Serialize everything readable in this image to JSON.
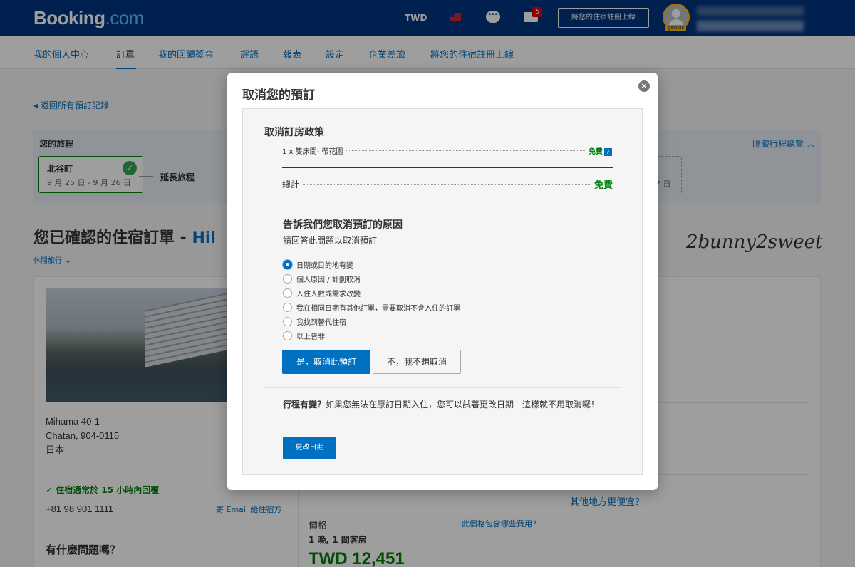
{
  "header": {
    "logo_main": "Booking",
    "logo_dot": ".com",
    "currency": "TWD",
    "mail_badge": "5",
    "list_property": "將您的住宿註冊上線",
    "genius": "genius"
  },
  "subnav": {
    "items": [
      {
        "label": "我的個人中心"
      },
      {
        "label": "訂單"
      },
      {
        "label": "我的回饋獎金"
      },
      {
        "label": "評語"
      },
      {
        "label": "報表"
      },
      {
        "label": "設定"
      },
      {
        "label": "企業差旅"
      },
      {
        "label": "將您的住宿註冊上線"
      }
    ]
  },
  "back_link": "◂ 返回所有預訂記錄",
  "trip": {
    "title": "您的旅程",
    "city": "北谷町",
    "dates": "9 月 25 日 - 9 月 26 日",
    "extend": "延長旅程",
    "hide_overview": "隱藏行程總覽 ︿",
    "dashed_card_text": "7 日"
  },
  "confirm": {
    "title": "您已確認的住宿訂單 - ",
    "title_hl": "Hil",
    "leisure": "休閒旅行"
  },
  "watermark": "2bunny2sweet",
  "hotel": {
    "addr_1": "Mihama 40-1",
    "addr_2": "Chatan, 904-0115",
    "addr_3": "日本",
    "reply": "住宿通常於 15 小時內回覆",
    "phone": "+81 98 901 1111",
    "email_prop": "寄 Email 給住宿方",
    "faq": "有什麼問題嗎？"
  },
  "price": {
    "label": "價格",
    "nights": "1 晚, 1 間客房",
    "value": "TWD 12,451",
    "info": "此價格包含哪些費用？"
  },
  "sidebar": {
    "cheaper": "其他地方更便宜？"
  },
  "modal": {
    "title": "取消您的預訂",
    "close": "×",
    "policy": {
      "title": "取消訂房政策",
      "room": "1 x 雙床間- 帶花園",
      "room_fee": "免費",
      "total_label": "總計",
      "total_fee": "免費"
    },
    "reason": {
      "title": "告訴我們您取消預訂的原因",
      "subtitle": "請回答此問題以取消預訂",
      "options": [
        {
          "label": "日期或目的地有變",
          "checked": true
        },
        {
          "label": "個人原因 / 計劃取消",
          "checked": false
        },
        {
          "label": "入住人數或需求改變",
          "checked": false
        },
        {
          "label": "我在相同日期有其他訂單，需要取消不會入住的訂單",
          "checked": false
        },
        {
          "label": "我找到替代住宿",
          "checked": false
        },
        {
          "label": "以上皆非",
          "checked": false
        }
      ]
    },
    "yes_button": "是，取消此預訂",
    "no_button": "不，我不想取消",
    "change": {
      "bold": "行程有變？",
      "text": "如果您無法在原訂日期入住，您可以試著更改日期 - 這樣就不用取消囉！",
      "button": "更改日期"
    }
  },
  "colors": {
    "brand": "#003580",
    "link": "#0071c2",
    "success": "#008009"
  }
}
